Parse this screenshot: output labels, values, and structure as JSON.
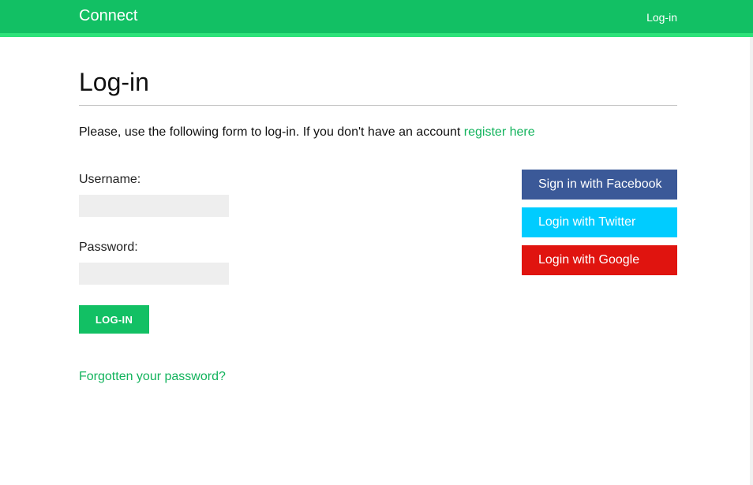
{
  "header": {
    "brand": "Connect",
    "nav_login": "Log-in"
  },
  "page": {
    "title": "Log-in",
    "intro_text": "Please, use the following form to log-in. If you don't have an account ",
    "register_link": "register here"
  },
  "form": {
    "username_label": "Username:",
    "username_value": "",
    "password_label": "Password:",
    "password_value": "",
    "submit_label": "LOG-IN",
    "forgot_link": "Forgotten your password?"
  },
  "social": [
    {
      "label": "Sign in with Facebook",
      "color": "#3b5998"
    },
    {
      "label": "Login with Twitter",
      "color": "#00ccff"
    },
    {
      "label": "Login with Google",
      "color": "#e0140f"
    }
  ],
  "colors": {
    "accent": "#12c064",
    "accent_border": "#2ee27a",
    "link": "#12b35c"
  }
}
